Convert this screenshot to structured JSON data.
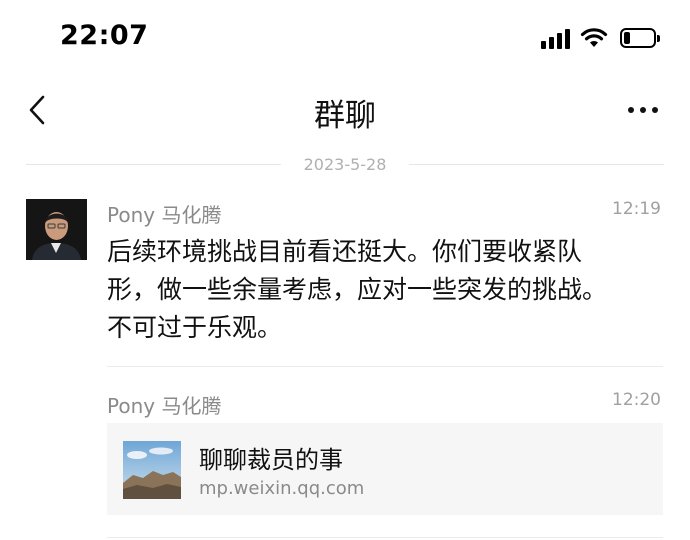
{
  "status_bar": {
    "time": "22:07",
    "icons": [
      "cellular-signal-icon",
      "wifi-icon",
      "battery-icon"
    ],
    "battery_level": 0.2
  },
  "nav": {
    "title": "群聊",
    "back_icon": "chevron-left-icon",
    "more_icon": "more-dots-icon"
  },
  "date_divider": "2023-5-28",
  "messages": [
    {
      "sender": "Pony 马化腾",
      "time": "12:19",
      "lines": [
        "后续环境挑战目前看还挺大。你们要收紧队",
        "形，做一些余量考虑，应对一些突发的挑战。",
        "不可过于乐观。"
      ]
    },
    {
      "sender": "Pony 马化腾",
      "time": "12:20",
      "link": {
        "title": "聊聊裁员的事",
        "domain": "mp.weixin.qq.com",
        "thumbnail": "landscape-thumbnail"
      }
    }
  ],
  "colors": {
    "background": "#ffffff",
    "secondary_text": "#8a8a8a",
    "divider": "#ebebeb",
    "card_background": "#f6f6f6"
  }
}
